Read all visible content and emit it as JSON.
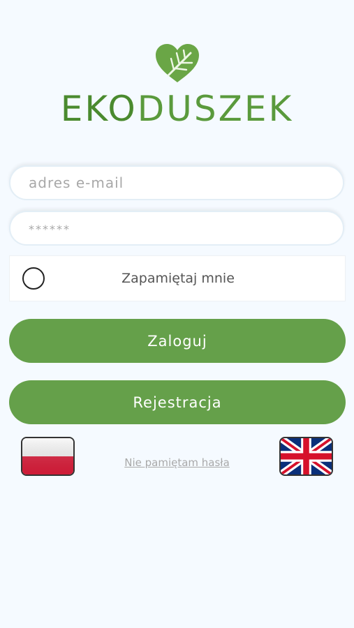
{
  "app": {
    "logo_text_left": "EKO",
    "logo_text_right": "DUSZEK",
    "brand_color": "#65a04a"
  },
  "form": {
    "email_placeholder": "adres e-mail",
    "password_placeholder": "******",
    "remember_label": "Zapamiętaj mnie",
    "login_label": "Zaloguj",
    "register_label": "Rejestracja",
    "forgot_label": "Nie pamiętam hasła"
  },
  "languages": {
    "left_flag_icon": "poland-flag-icon",
    "right_flag_icon": "uk-flag-icon"
  }
}
